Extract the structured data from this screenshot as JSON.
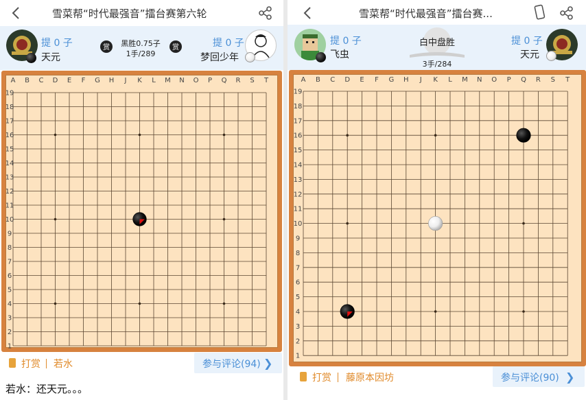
{
  "left": {
    "title": "雪菜帮“时代最强音”擂台赛第六轮",
    "black_player": {
      "captured": "提 0 子",
      "name": "天元"
    },
    "white_player": {
      "captured": "提 0 子",
      "name": "梦回少年"
    },
    "result": "黑胜0.75子",
    "moves": "1手/289",
    "board": {
      "columns": [
        "A",
        "B",
        "C",
        "D",
        "E",
        "F",
        "G",
        "H",
        "J",
        "K",
        "L",
        "M",
        "N",
        "O",
        "P",
        "Q",
        "R",
        "S",
        "T"
      ],
      "stones": [
        {
          "color": "black",
          "col": "K",
          "row": 10,
          "last_move": true
        }
      ]
    },
    "reward_label": "打赏",
    "author": "若水",
    "comment_button": "参与评论(94)",
    "comment": "若水：还天元。。。"
  },
  "right": {
    "title": "雪菜帮“时代最强音”擂台赛...",
    "black_player": {
      "captured": "提 0 子",
      "name": "飞虫"
    },
    "white_player": {
      "captured": "提 0 子",
      "name": "天元"
    },
    "result": "白中盘胜",
    "moves": "3手/284",
    "board": {
      "columns": [
        "A",
        "B",
        "C",
        "D",
        "E",
        "F",
        "G",
        "H",
        "J",
        "K",
        "L",
        "M",
        "N",
        "O",
        "P",
        "Q",
        "R",
        "S",
        "T"
      ],
      "stones": [
        {
          "color": "black",
          "col": "Q",
          "row": 16,
          "last_move": false
        },
        {
          "color": "white",
          "col": "K",
          "row": 10,
          "last_move": false
        },
        {
          "color": "black",
          "col": "D",
          "row": 4,
          "last_move": true
        }
      ]
    },
    "reward_label": "打赏",
    "author": "藤原本因坊",
    "comment_button": "参与评论(90)"
  }
}
